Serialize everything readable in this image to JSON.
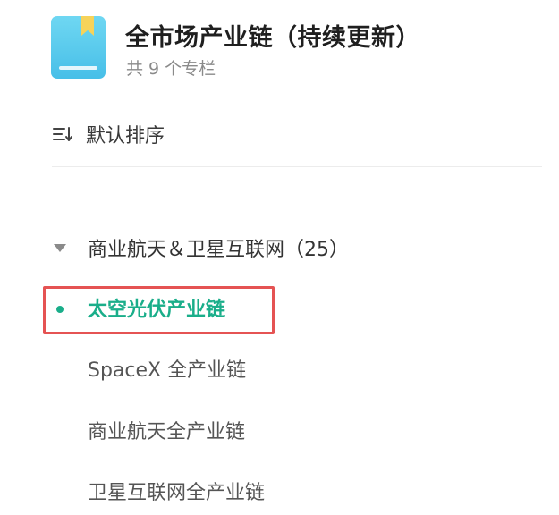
{
  "header": {
    "icon": "book-icon",
    "title": "全市场产业链（持续更新）",
    "subtitle": "共 9 个专栏"
  },
  "sort": {
    "icon": "sort-icon",
    "label": "默认排序"
  },
  "tree": {
    "group": {
      "label": "商业航天＆卫星互联网（25）",
      "expanded": true
    },
    "items": [
      {
        "label": "太空光伏产业链",
        "active": true
      },
      {
        "label": "SpaceX 全产业链",
        "active": false
      },
      {
        "label": "商业航天全产业链",
        "active": false
      },
      {
        "label": "卫星互联网全产业链",
        "active": false
      }
    ]
  },
  "colors": {
    "accent": "#1aae8a",
    "highlight_border": "#e55353",
    "icon_blue": "#47bfe8",
    "ribbon_yellow": "#f6d35a"
  }
}
